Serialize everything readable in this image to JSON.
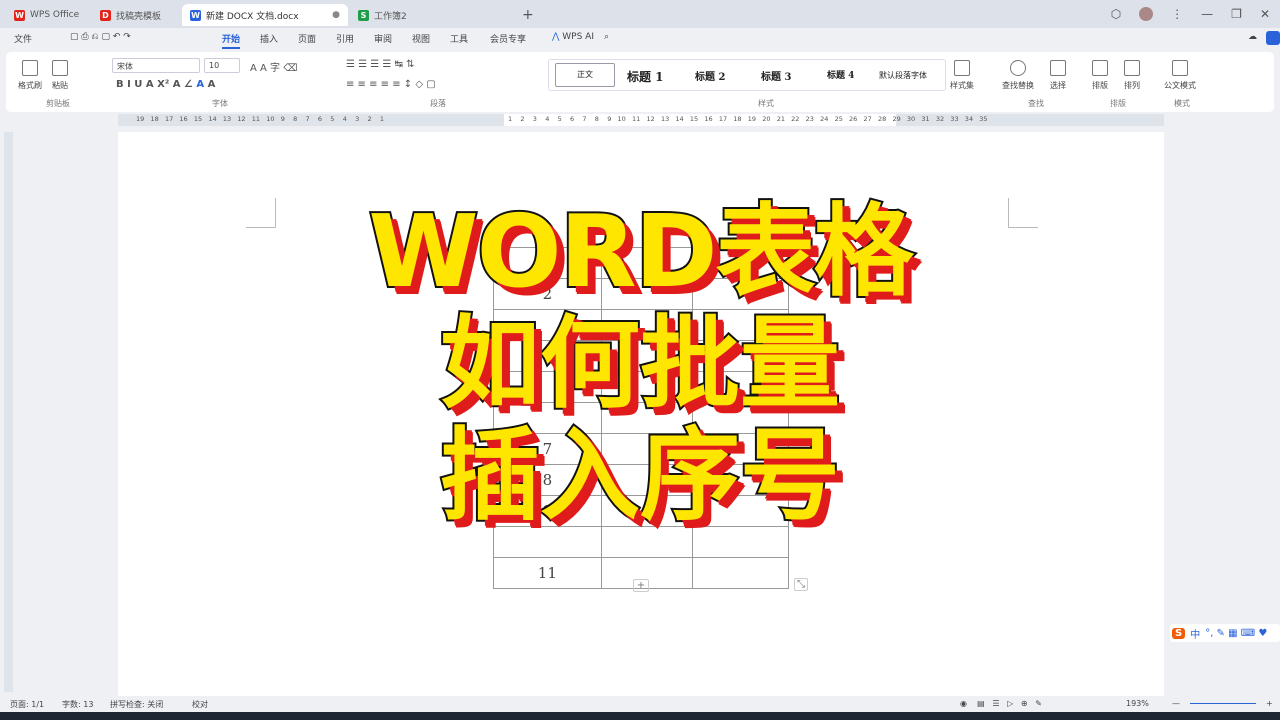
{
  "tabs": [
    {
      "label": "WPS Office",
      "color": "#e2231a"
    },
    {
      "label": "找稿壳模板",
      "color": "#e2231a"
    },
    {
      "label": "新建 DOCX 文档.docx",
      "color": "#2a62d9"
    },
    {
      "label": "工作簿2",
      "color": "#1e9e4a"
    }
  ],
  "menu": {
    "file": "文件",
    "items": [
      "开始",
      "插入",
      "页面",
      "引用",
      "审阅",
      "视图",
      "工具",
      "会员专享"
    ],
    "ai": "WPS AI"
  },
  "ribbon": {
    "format_painter": "格式刷",
    "paste": "粘贴",
    "clipboard": "剪贴板",
    "font_name": "宋体",
    "font_size": "10",
    "font_group": "字体",
    "paragraph_group": "段落",
    "styles": [
      "正文",
      "标题 1",
      "标题 2",
      "标题 3",
      "标题 4",
      "默认段落字体"
    ],
    "style_group": "样式",
    "style_set": "样式集",
    "find_replace": "查找替换",
    "select": "选择",
    "find_group": "查找",
    "layout": "排版",
    "arrange": "排列",
    "layout_group": "排版",
    "doc_style": "公文模式",
    "mode_group": "模式"
  },
  "table": {
    "visible_rows": [
      "",
      "2",
      "",
      "",
      "",
      "",
      "7",
      "8",
      "9",
      "",
      "11"
    ]
  },
  "overlay": {
    "line1": "WORD表格",
    "line2": "如何批量",
    "line3": "插入序号"
  },
  "status": {
    "page": "页面: 1/1",
    "words": "字数: 13",
    "spell": "拼写检查: 关闭",
    "proof": "校对",
    "zoom": "193%"
  },
  "ime": {
    "label": "中"
  }
}
